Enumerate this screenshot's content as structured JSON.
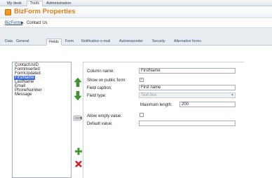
{
  "topnav": {
    "tabs": [
      "My desk",
      "Tools",
      "Administration"
    ],
    "active": 1
  },
  "header": {
    "title": "BizForm Properties"
  },
  "breadcrumb": {
    "root": "BizForms",
    "separator": "▶",
    "current": "Contact Us"
  },
  "tabs": [
    "Data",
    "General",
    "Fields",
    "Form",
    "Notification e-mail",
    "Autoresponder",
    "Security",
    "Alternative forms"
  ],
  "active_tab": 2,
  "fields_list": {
    "items": [
      "ContactUsID",
      "FormInserted",
      "FormUpdated",
      "FirstName",
      "LastName",
      "Email",
      "PhoneNumber",
      "Message"
    ],
    "selected": 3
  },
  "form": {
    "column_name": {
      "label": "Column name:",
      "value": "FirstName"
    },
    "show_public": {
      "label": "Show on public form:",
      "checked": true,
      "mark": "✓"
    },
    "field_caption": {
      "label": "Field caption:",
      "value": "First name"
    },
    "field_type": {
      "label": "Field type:",
      "value": "Text box"
    },
    "max_length": {
      "label": "Maximum length:",
      "value": "200"
    },
    "allow_empty": {
      "label": "Allow empty value:",
      "checked": false
    },
    "default_value": {
      "label": "Default value:",
      "value": ""
    }
  },
  "icons": [
    "move-up-icon",
    "move-down-icon",
    "attach-icon",
    "add-icon",
    "delete-icon"
  ],
  "colors": {
    "accent": "#e07d10",
    "selection": "#3b6bd6",
    "add": "#3c9a2e",
    "delete": "#cc2222"
  }
}
